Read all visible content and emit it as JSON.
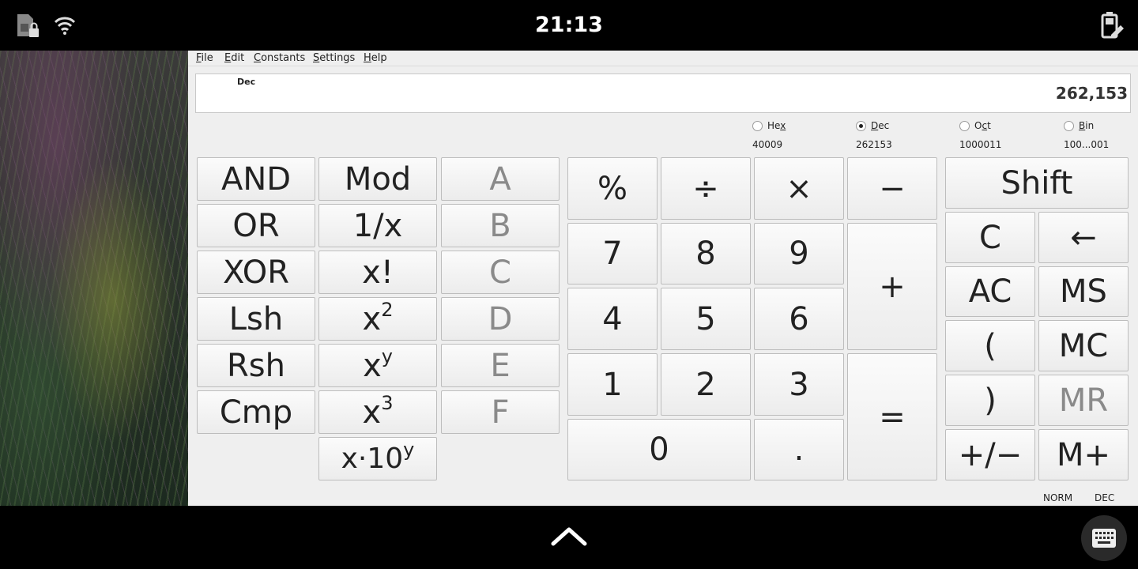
{
  "status_bar": {
    "time": "21:13",
    "icons": {
      "left": [
        "sim-locked-icon",
        "wifi-icon"
      ],
      "right": [
        "battery-edit-icon"
      ]
    }
  },
  "menubar": {
    "items": [
      {
        "label": "File",
        "mnemonic": "F",
        "rest": "ile"
      },
      {
        "label": "Edit",
        "mnemonic": "E",
        "rest": "dit"
      },
      {
        "label": "Constants",
        "mnemonic": "C",
        "rest": "onstants"
      },
      {
        "label": "Settings",
        "mnemonic": "S",
        "rest": "ettings"
      },
      {
        "label": "Help",
        "mnemonic": "H",
        "rest": "elp"
      }
    ]
  },
  "display": {
    "mode": "Dec",
    "value": "262,153"
  },
  "bases": [
    {
      "pre": "He",
      "mn": "x",
      "post": "",
      "value": "40009",
      "selected": false
    },
    {
      "pre": "",
      "mn": "D",
      "post": "ec",
      "value": "262153",
      "selected": true
    },
    {
      "pre": "O",
      "mn": "c",
      "post": "t",
      "value": "1000011",
      "selected": false
    },
    {
      "pre": "",
      "mn": "B",
      "post": "in",
      "value": "100...001",
      "selected": false
    }
  ],
  "buttons": {
    "logic": [
      "AND",
      "OR",
      "XOR",
      "Lsh",
      "Rsh",
      "Cmp"
    ],
    "func": {
      "mod": "Mod",
      "recip": "1/x",
      "fact": "x!",
      "sq_base": "x",
      "sq_exp": "2",
      "pow_base": "x",
      "pow_exp": "y",
      "cube_base": "x",
      "cube_exp": "3",
      "sci_base": "x·10",
      "sci_exp": "y"
    },
    "hex": [
      "A",
      "B",
      "C",
      "D",
      "E",
      "F"
    ],
    "ops": {
      "percent": "%",
      "divide": "÷",
      "multiply": "×",
      "minus": "−",
      "plus": "+",
      "equals": "=",
      "dot": "."
    },
    "digits": {
      "d0": "0",
      "d1": "1",
      "d2": "2",
      "d3": "3",
      "d4": "4",
      "d5": "5",
      "d6": "6",
      "d7": "7",
      "d8": "8",
      "d9": "9"
    },
    "mem": {
      "shift": "Shift",
      "clear": "C",
      "backspace": "←",
      "all_clear": "AC",
      "ms": "MS",
      "lparen": "(",
      "mc": "MC",
      "rparen": ")",
      "mr": "MR",
      "negate": "+/−",
      "mplus": "M+"
    }
  },
  "statusline": {
    "angle": "NORM",
    "base": "DEC"
  },
  "colors": {
    "app_bg": "#efefef",
    "disabled_text": "#8a8a8a"
  }
}
